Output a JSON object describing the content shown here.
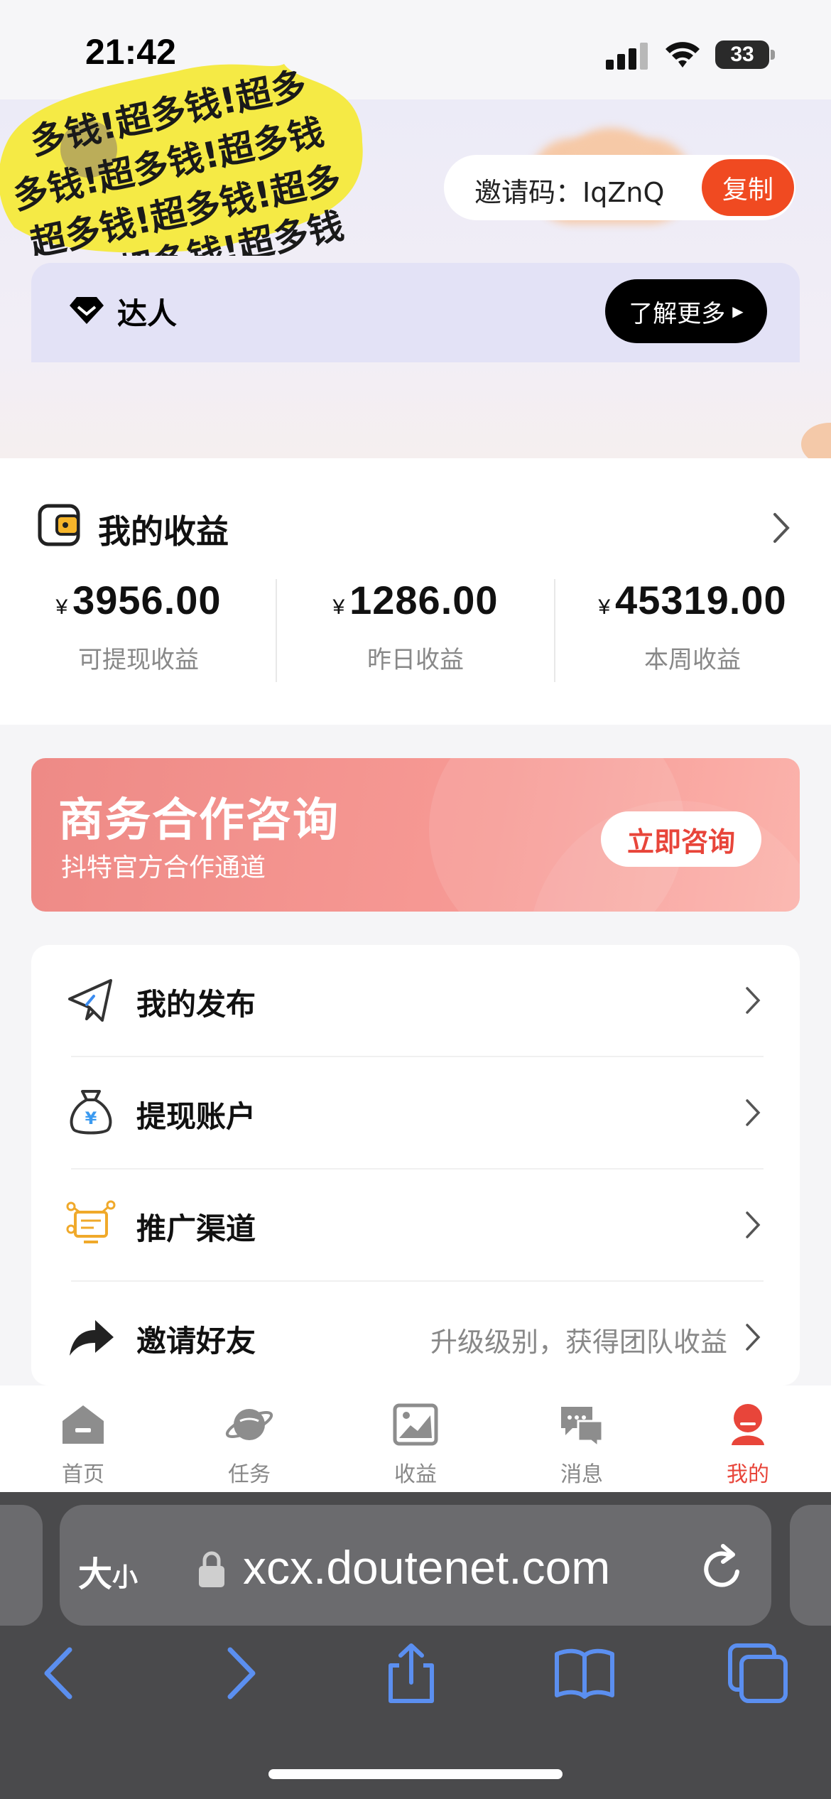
{
  "status_bar": {
    "time": "21:42",
    "battery": "33"
  },
  "header": {
    "avatar_text": "多钱!超多钱!超多钱!超",
    "invite_label": "邀请码：",
    "invite_code": "IqZnQ",
    "copy_label": "复制",
    "vip_label": "达人",
    "learn_more_label": "了解更多"
  },
  "earnings": {
    "title": "我的收益",
    "currency": "¥",
    "items": [
      {
        "value": "3956.00",
        "label": "可提现收益"
      },
      {
        "value": "1286.00",
        "label": "昨日收益"
      },
      {
        "value": "45319.00",
        "label": "本周收益"
      }
    ]
  },
  "banner": {
    "title": "商务合作咨询",
    "subtitle": "抖特官方合作通道",
    "button": "立即咨询"
  },
  "menu": [
    {
      "label": "我的发布",
      "hint": ""
    },
    {
      "label": "提现账户",
      "hint": ""
    },
    {
      "label": "推广渠道",
      "hint": ""
    },
    {
      "label": "邀请好友",
      "hint": "升级级别，获得团队收益"
    }
  ],
  "tabs": [
    {
      "label": "首页",
      "icon": "home-icon",
      "active": false
    },
    {
      "label": "任务",
      "icon": "planet-icon",
      "active": false
    },
    {
      "label": "收益",
      "icon": "chart-image-icon",
      "active": false
    },
    {
      "label": "消息",
      "icon": "chat-icon",
      "active": false
    },
    {
      "label": "我的",
      "icon": "user-icon",
      "active": true
    }
  ],
  "browser": {
    "text_size_label": "大",
    "text_size_small": "小",
    "url": "xcx.doutenet.com"
  },
  "colors": {
    "accent": "#f04a21",
    "active_tab": "#e8453a",
    "banner": "#f79a95",
    "ios_blue": "#5b8ff0"
  }
}
